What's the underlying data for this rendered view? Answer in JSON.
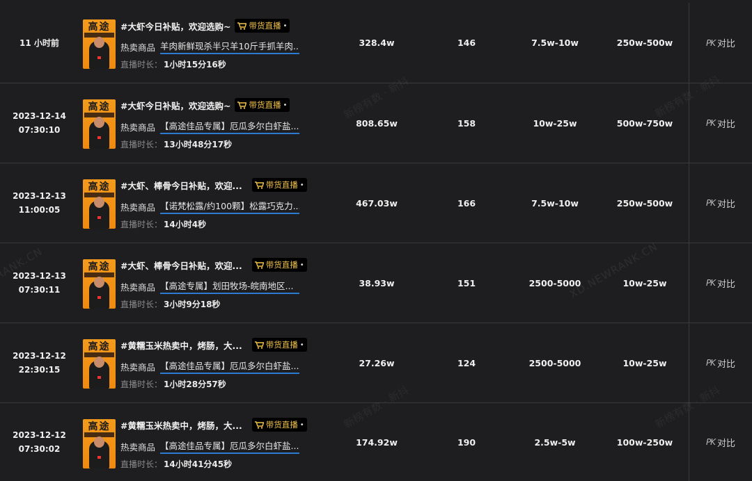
{
  "tag": {
    "label": "带货直播",
    "dot": "•"
  },
  "labels": {
    "goods": "热卖商品",
    "duration": "直播时长：",
    "pk": "对比",
    "pk_icon": "PK"
  },
  "thumb": {
    "title": "高途"
  },
  "watermarks": [
    "新榜有数 · 新抖",
    "新榜有数 · 新抖",
    "XD.NEWRANK.CN",
    "RANK.CN",
    "新榜有数 · 新抖",
    "新榜有数 · 新抖"
  ],
  "rows": [
    {
      "time1": "11 小时前",
      "time2": "",
      "title": "#大虾今日补贴，欢迎选购~",
      "goods": "羊肉新鲜现杀半只羊10斤手抓羊肉...",
      "duration": "1小时15分16秒",
      "v1": "328.4w",
      "v2": "146",
      "v3": "7.5w-10w",
      "v4": "250w-500w"
    },
    {
      "time1": "2023-12-14",
      "time2": "07:30:10",
      "title": "#大虾今日补贴，欢迎选购~",
      "goods": "【高途佳品专属】厄瓜多尔白虾盐...",
      "duration": "13小时48分17秒",
      "v1": "808.65w",
      "v2": "158",
      "v3": "10w-25w",
      "v4": "500w-750w"
    },
    {
      "time1": "2023-12-13",
      "time2": "11:00:05",
      "title": "#大虾、棒骨今日补贴，欢迎...",
      "goods": "【诺梵松露/约100颗】松露巧克力...",
      "duration": "14小时4秒",
      "v1": "467.03w",
      "v2": "166",
      "v3": "7.5w-10w",
      "v4": "250w-500w"
    },
    {
      "time1": "2023-12-13",
      "time2": "07:30:11",
      "title": "#大虾、棒骨今日补贴，欢迎...",
      "goods": "【高途专属】划田牧场-皖南地区...",
      "duration": "3小时9分18秒",
      "v1": "38.93w",
      "v2": "151",
      "v3": "2500-5000",
      "v4": "10w-25w"
    },
    {
      "time1": "2023-12-12",
      "time2": "22:30:15",
      "title": "#黄糯玉米热卖中，烤肠，大...",
      "goods": "【高途佳品专属】厄瓜多尔白虾盐...",
      "duration": "1小时28分57秒",
      "v1": "27.26w",
      "v2": "124",
      "v3": "2500-5000",
      "v4": "10w-25w"
    },
    {
      "time1": "2023-12-12",
      "time2": "07:30:02",
      "title": "#黄糯玉米热卖中，烤肠，大...",
      "goods": "【高途佳品专属】厄瓜多尔白虾盐...",
      "duration": "14小时41分45秒",
      "v1": "174.92w",
      "v2": "190",
      "v3": "2.5w-5w",
      "v4": "100w-250w"
    }
  ]
}
